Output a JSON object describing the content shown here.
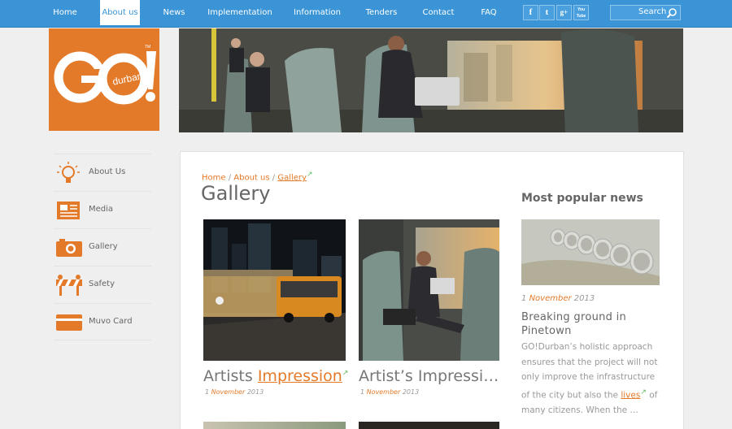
{
  "nav": {
    "items": [
      {
        "label": "Home"
      },
      {
        "label": "About us"
      },
      {
        "label": "News"
      },
      {
        "label": "Implementation"
      },
      {
        "label": "Information"
      },
      {
        "label": "Tenders"
      },
      {
        "label": "Contact"
      },
      {
        "label": "FAQ"
      }
    ],
    "social": {
      "facebook": "f",
      "twitter": "t",
      "googleplus": "g+",
      "youtube": "You Tube"
    },
    "search_label": "Search"
  },
  "logo": {
    "text": "GO!",
    "sub": "durban",
    "tm": "TM"
  },
  "sidebar": {
    "items": [
      {
        "label": "About Us",
        "icon": "lightbulb-icon"
      },
      {
        "label": "Media",
        "icon": "newspaper-icon"
      },
      {
        "label": "Gallery",
        "icon": "camera-icon"
      },
      {
        "label": "Safety",
        "icon": "barrier-icon"
      },
      {
        "label": "Muvo Card",
        "icon": "card-icon"
      }
    ]
  },
  "breadcrumb": {
    "home": "Home",
    "about": "About us",
    "current": "Gallery",
    "sep": "/"
  },
  "page_title": "Gallery",
  "gallery": {
    "items": [
      {
        "title_prefix": "Artists ",
        "title_link": "Impression",
        "day": "1",
        "month": "November",
        "year": "2013"
      },
      {
        "title": "Artist’s Impressi…",
        "day": "1",
        "month": "November",
        "year": "2013"
      }
    ]
  },
  "popular": {
    "heading": "Most popular news",
    "day": "1",
    "month": "November",
    "year": "2013",
    "title": "Breaking ground in Pinetown",
    "body_before": "GO!Durban’s holistic approach ensures that the project will not only improve the infrastructure of the city but also the ",
    "body_link": "lives",
    "body_after": " of many citizens. When the …"
  },
  "colors": {
    "nav_blue": "#3a94d6",
    "brand_orange": "#e37a29"
  }
}
